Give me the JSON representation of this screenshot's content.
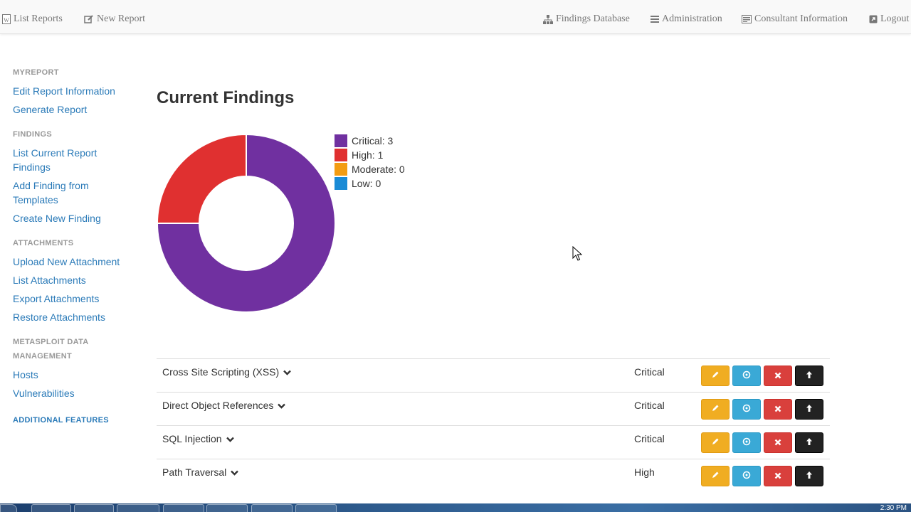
{
  "nav": {
    "list_reports": "List Reports",
    "new_report": "New Report",
    "findings_database": "Findings Database",
    "administration": "Administration",
    "consultant_information": "Consultant Information",
    "logout": "Logout"
  },
  "sidebar": {
    "section_myreport": "MYREPORT",
    "edit_report_information": "Edit Report Information",
    "generate_report": "Generate Report",
    "section_findings": "FINDINGS",
    "list_current_report_findings_1": "List Current Report",
    "list_current_report_findings_2": "Findings",
    "add_finding_from_templates_1": "Add Finding from",
    "add_finding_from_templates_2": "Templates",
    "create_new_finding": "Create New Finding",
    "section_attachments": "ATTACHMENTS",
    "upload_new_attachment": "Upload New Attachment",
    "list_attachments": "List Attachments",
    "export_attachments": "Export Attachments",
    "restore_attachments": "Restore Attachments",
    "section_metasploit_1": "METASPLOIT DATA",
    "section_metasploit_2": "MANAGEMENT",
    "hosts": "Hosts",
    "vulnerabilities": "Vulnerabilities",
    "additional_features": "ADDITIONAL FEATURES"
  },
  "main": {
    "title": "Current Findings"
  },
  "chart_data": {
    "type": "pie",
    "categories": [
      "Critical",
      "High",
      "Moderate",
      "Low"
    ],
    "values": [
      3,
      1,
      0,
      0
    ],
    "colors": [
      "#7030a0",
      "#e03030",
      "#f39c12",
      "#1a8bd6"
    ],
    "legend": [
      "Critical: 3",
      "High: 1",
      "Moderate: 0",
      "Low: 0"
    ],
    "legend_position": "right",
    "donut": true
  },
  "findings": [
    {
      "title": "Cross Site Scripting (XSS)",
      "severity": "Critical"
    },
    {
      "title": "Direct Object References",
      "severity": "Critical"
    },
    {
      "title": "SQL Injection",
      "severity": "Critical"
    },
    {
      "title": "Path Traversal",
      "severity": "High"
    }
  ],
  "taskbar": {
    "clock": "2:30 PM"
  },
  "colors": {
    "link": "#2a7ab8",
    "edit_button": "#f0ad22",
    "view_button": "#3aa9d6",
    "delete_button": "#d9403c",
    "upload_button": "#222222"
  },
  "icons": {
    "list_reports": "word-doc-icon",
    "new_report": "edit-icon",
    "findings_database": "sitemap-icon",
    "administration": "menu-icon",
    "consultant_information": "id-card-icon",
    "logout": "external-link-icon",
    "row_expand": "chevron-down-icon",
    "edit": "pencil-icon",
    "view": "circle-dot-icon",
    "delete": "x-icon",
    "upload": "arrow-up-icon"
  }
}
